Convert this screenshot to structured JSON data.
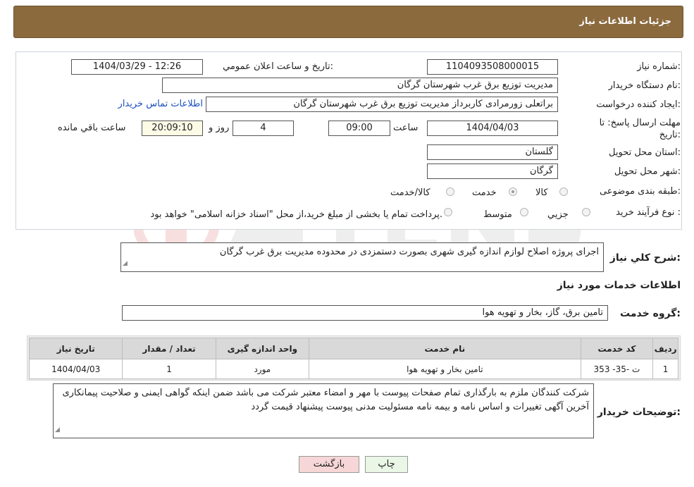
{
  "header": {
    "title": "جزئیات اطلاعات نیاز"
  },
  "form": {
    "need_number": {
      "label": "شماره نیاز:",
      "value": "1104093508000015"
    },
    "announce_datetime": {
      "label": "تاریخ و ساعت اعلان عمومي:",
      "value": "1404/03/29 - 12:26"
    },
    "buyer_org": {
      "label": "نام دستگاه خریدار:",
      "value": "مدیریت توزیع برق غرب شهرستان گرگان"
    },
    "requester": {
      "label": "ایجاد کننده درخواست:",
      "value": "براتعلی زورمرادی کاربرداز مدیریت توزیع برق غرب شهرستان گرگان"
    },
    "contact_link": "اطلاعات تماس خریدار",
    "deadline": {
      "label": "مهلت ارسال پاسخ: تا تاریخ:",
      "date": "1404/04/03",
      "time_label": "ساعت",
      "time": "09:00",
      "days": "4",
      "days_label": "روز و",
      "remaining": "20:09:10",
      "remaining_label": "ساعت باقي مانده"
    },
    "province": {
      "label": "استان محل تحویل:",
      "value": "گلستان"
    },
    "city": {
      "label": "شهر محل تحویل:",
      "value": "گرگان"
    },
    "category": {
      "label": "طبقه بندی موضوعی:",
      "options": [
        "کالا",
        "خدمت",
        "کالا/خدمت"
      ],
      "selected": "خدمت"
    },
    "purchase_process": {
      "label": "نوع فرآیند خرید :",
      "options": [
        "جزیي",
        "متوسط"
      ],
      "note": "پرداخت تمام یا بخشی از مبلغ خرید،از محل \"اسناد خزانه اسلامی\" خواهد بود."
    }
  },
  "summary": {
    "label": "شرح کلي نیاز:",
    "value": "اجرای پروژه اصلاح لوازم اندازه گیری شهری بصورت دستمزدی در محدوده مدیریت برق غرب گرگان"
  },
  "services_section": {
    "title": "اطلاعات خدمات مورد نیاز"
  },
  "service_group": {
    "label": "گروه خدمت:",
    "value": "تامین برق، گاز، بخار و تهویه هوا"
  },
  "table": {
    "headers": [
      "ردیف",
      "کد خدمت",
      "نام خدمت",
      "واحد اندازه گیری",
      "تعداد / مقدار",
      "تاریخ نیاز"
    ],
    "rows": [
      [
        "1",
        "ت -35- 353",
        "تامین بخار و تهویه هوا",
        "مورد",
        "1",
        "1404/04/03"
      ]
    ]
  },
  "buyer_notes": {
    "label": "توضیحات خریدار:",
    "value": "شرکت کنندگان ملزم به بارگذاری تمام صفحات پیوست با مهر و امضاء معتبر شرکت می باشد ضمن اینکه گواهی ایمنی و صلاحیت پیمانکاری آخرین آگهی تغییرات و اساس نامه و بیمه نامه مسئولیت مدنی پیوست پیشنهاد قیمت گردد"
  },
  "buttons": {
    "print": "چاپ",
    "back": "بازگشت"
  },
  "colors": {
    "header_bg": "#8b6a3e",
    "back_btn": "#f6d6d6",
    "print_btn": "#eaf6e6"
  }
}
